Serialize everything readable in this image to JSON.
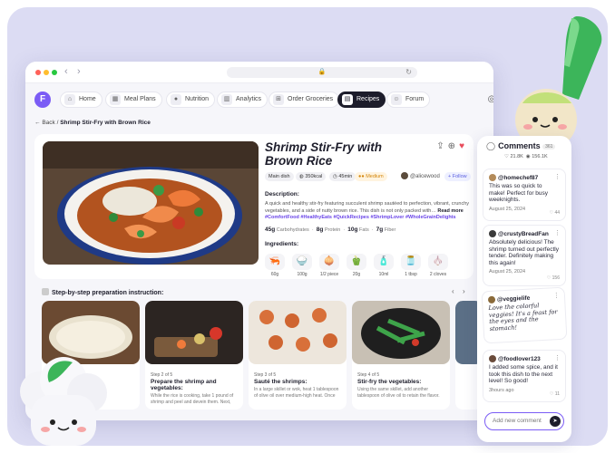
{
  "browser": {
    "url_icon": "lock-icon"
  },
  "nav": {
    "logo": "F",
    "tabs": [
      {
        "label": "Home",
        "icon": "home-icon"
      },
      {
        "label": "Meal Plans",
        "icon": "calendar-icon"
      },
      {
        "label": "Nutrition",
        "icon": "apple-icon"
      },
      {
        "label": "Analytics",
        "icon": "chart-icon"
      },
      {
        "label": "Order Groceries",
        "icon": "cart-icon"
      },
      {
        "label": "Recipes",
        "icon": "book-icon"
      },
      {
        "label": "Forum",
        "icon": "chat-icon"
      }
    ],
    "active_tab": "Recipes"
  },
  "breadcrumb": {
    "back": "Back",
    "separator": "/",
    "current": "Shrimp Stir-Fry with Brown Rice"
  },
  "recipe": {
    "title": "Shrimp Stir-Fry with Brown Rice",
    "category": "Main dish",
    "calories": "350kcal",
    "time": "45min",
    "difficulty": "Medium",
    "author": "@alicewood",
    "follow": "Follow",
    "description_label": "Description:",
    "description": "A quick and healthy stir-fry featuring succulent shrimp sautéed to perfection, vibrant, crunchy vegetables, and a side of nutty brown rice. This dish is not only packed with…",
    "read_more": "Read more",
    "hashtags": "#ComfortFood #HealthyEats #QuickRecipes #ShrimpLover #WholeGrainDelights",
    "nutrition": [
      {
        "value": "45g",
        "label": "Carbohydrates"
      },
      {
        "value": "8g",
        "label": "Protein"
      },
      {
        "value": "10g",
        "label": "Fats"
      },
      {
        "value": "7g",
        "label": "Fiber"
      }
    ],
    "ingredients_label": "Ingredients:",
    "ingredients": [
      {
        "qty": "60g",
        "icon": "shrimp-icon"
      },
      {
        "qty": "100g",
        "icon": "rice-icon"
      },
      {
        "qty": "1/2 piece",
        "icon": "onion-icon"
      },
      {
        "qty": "20g",
        "icon": "pepper-icon"
      },
      {
        "qty": "10ml",
        "icon": "sauce-icon"
      },
      {
        "qty": "1 tbsp",
        "icon": "oil-icon"
      },
      {
        "qty": "2 cloves",
        "icon": "garlic-icon"
      }
    ]
  },
  "steps": {
    "header": "Step-by-step preparation instruction:",
    "items": [
      {
        "num": "",
        "title": "",
        "desc": ""
      },
      {
        "num": "Step 2 of 5",
        "title": "Prepare the shrimp and vegetables:",
        "desc": "While the rice is cooking, take 1 pound of shrimp and peel and devein them. Next,"
      },
      {
        "num": "Step 3 of 5",
        "title": "Sauté the shrimps:",
        "desc": "In a large skillet or wok, heat 1 tablespoon of olive oil over medium-high heat. Once"
      },
      {
        "num": "Step 4 of 5",
        "title": "Stir-fry the vegetables:",
        "desc": "Using the same skillet, add another tablespoon of olive oil to retain the flavor."
      }
    ],
    "partial_label": "e",
    "partial_desc": "ion"
  },
  "comments": {
    "title": "Comments",
    "count": "361",
    "likes": "21.8K",
    "views": "156.1K",
    "items": [
      {
        "user": "@homechef87",
        "text": "This was so quick to make! Perfect for busy weeknights.",
        "date": "August 25, 2024",
        "likes": "44"
      },
      {
        "user": "@crustyBreadFan",
        "text": "Absolutely delicious! The shrimp turned out perfectly tender. Definitely making this again!",
        "date": "August 25, 2024",
        "likes": "156"
      },
      {
        "user": "@veggielife",
        "text": "Love the colorful veggies! It's a feast for the eyes and the stomach!",
        "date": "",
        "likes": ""
      },
      {
        "user": "@foodlover123",
        "text": "I added some spice, and it took this dish to the next level! So good!",
        "date": "3hours ago",
        "likes": "11"
      }
    ],
    "placeholder": "Add new comment"
  },
  "colors": {
    "accent": "#7b5cf5",
    "dark": "#1d1d2b",
    "background": "#dcdcf3",
    "heart": "#e84b5b"
  }
}
